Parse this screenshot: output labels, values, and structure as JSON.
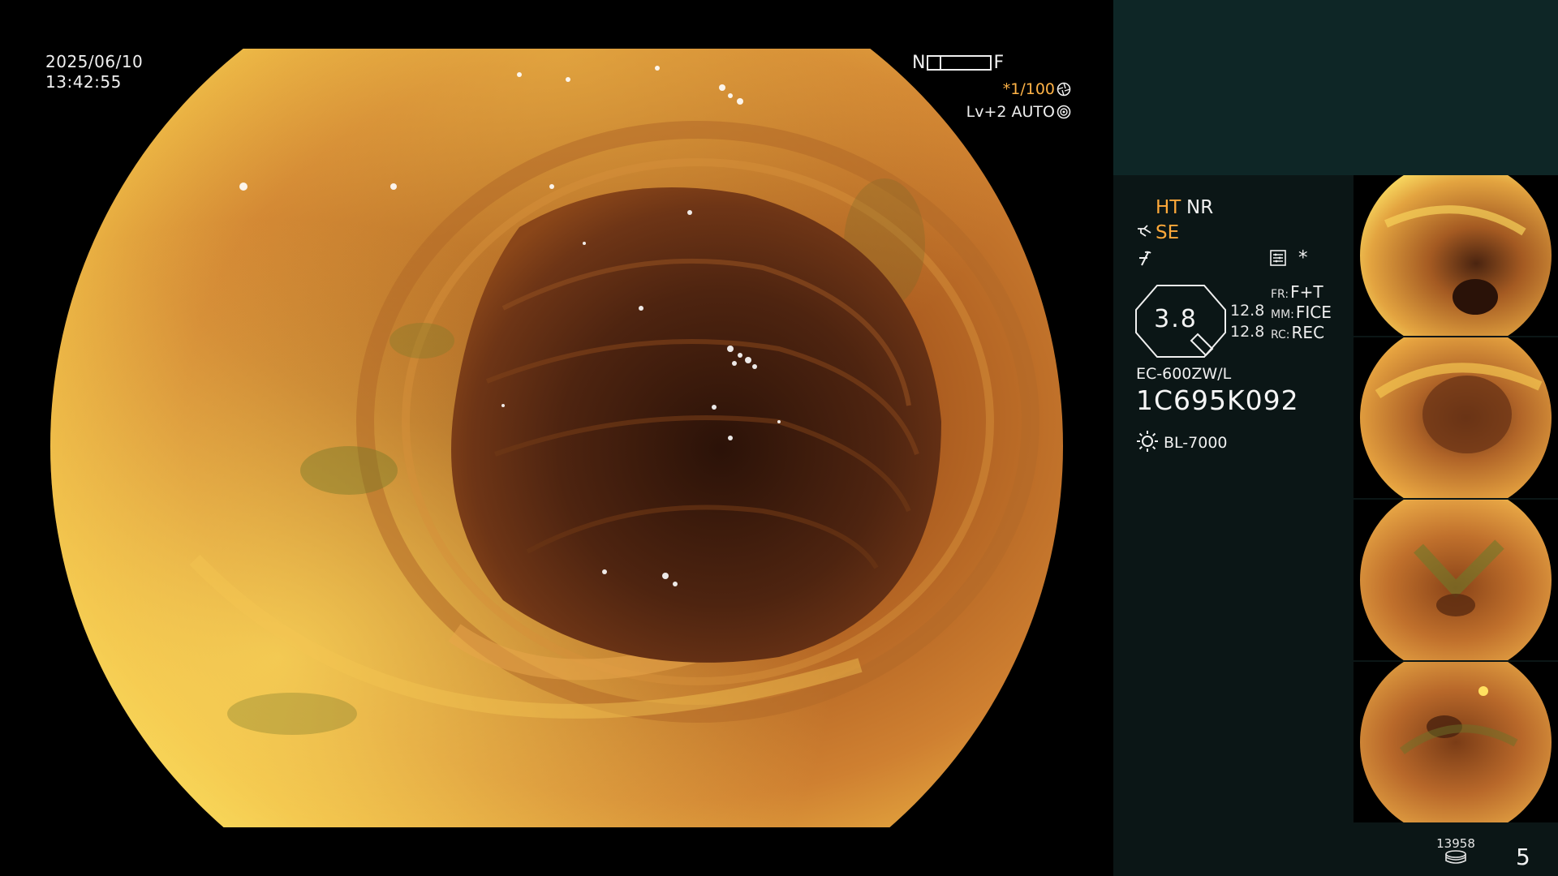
{
  "overlay": {
    "date": "2025/06/10",
    "time": "13:42:55",
    "near_label": "N",
    "far_label": "F",
    "focus_position": 0.18,
    "shutter_prefix": "*",
    "shutter": "1/100",
    "level": "Lv+2",
    "exposure_mode": "AUTO"
  },
  "panel": {
    "ht_label": "HT",
    "nr_label": "NR",
    "se_label": "SE",
    "star_label": "*",
    "zoom_value": "3.8",
    "value_1": "12.8",
    "value_2": "12.8",
    "fr": {
      "key": "FR:",
      "value": "F+T"
    },
    "mm": {
      "key": "MM:",
      "value": "FICE"
    },
    "rc": {
      "key": "RC:",
      "value": "REC"
    },
    "scope_model": "EC-600ZW/L",
    "scope_serial": "1C695K092",
    "light_source": "BL-7000",
    "image_counter": "13958",
    "page_number": "5"
  },
  "icons": {
    "shutter_icon": "aperture-icon",
    "exposure_icon": "auto-exposure-icon",
    "se_icon": "structure-enhancement-icon",
    "freeze_icon": "freeze-icon",
    "menu_icon": "menu-list-icon",
    "zoom_icon": "zoom-handle-icon",
    "light_icon": "sun-icon",
    "storage_icon": "disk-stack-icon"
  },
  "colors": {
    "accent": "#ffa93a",
    "panel_bg": "#0b1616",
    "panel_top_bg": "#0e2626",
    "text": "#f0f0f0"
  }
}
